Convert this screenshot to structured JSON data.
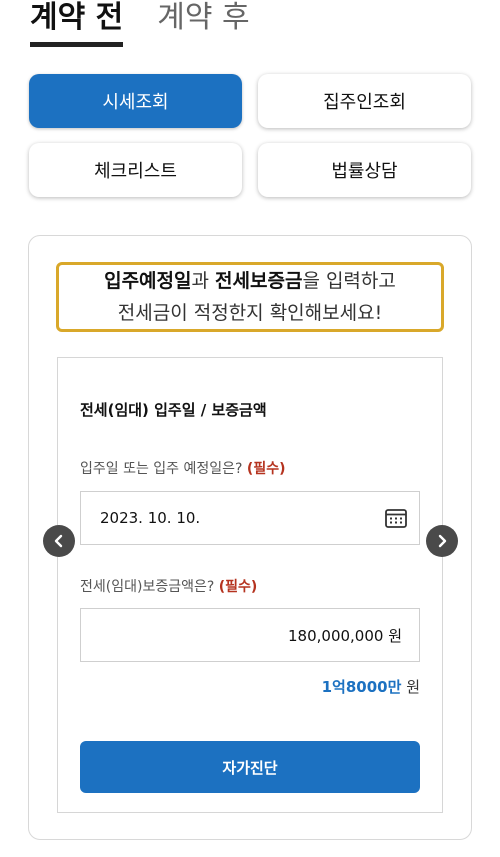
{
  "tabs": [
    {
      "label": "계약 전",
      "active": true
    },
    {
      "label": "계약 후",
      "active": false
    }
  ],
  "menu": {
    "price_lookup": "시세조회",
    "landlord_lookup": "집주인조회",
    "checklist": "체크리스트",
    "legal_consult": "법률상담"
  },
  "notice": {
    "line1_bold1": "입주예정일",
    "line1_text1": "과 ",
    "line1_bold2": "전세보증금",
    "line1_text2": "을 입력하고",
    "line2": "전세금이 적정한지 확인해보세요!"
  },
  "form": {
    "section_title": "전세(임대) 입주일 / 보증금액",
    "date_label": "입주일 또는 입주 예정일은?",
    "date_required": "(필수)",
    "date_value": "2023. 10. 10.",
    "amount_label": "전세(임대)보증금액은?",
    "amount_required": "(필수)",
    "amount_value": "180,000,000 원",
    "amount_korean_number": "1억8000만",
    "amount_korean_unit": "원",
    "submit_label": "자가진단"
  },
  "colors": {
    "primary": "#1c71c1",
    "notice_border": "#d9a82a",
    "required": "#b5331f"
  },
  "icons": [
    "calendar-icon",
    "chevron-left-icon",
    "chevron-right-icon"
  ]
}
